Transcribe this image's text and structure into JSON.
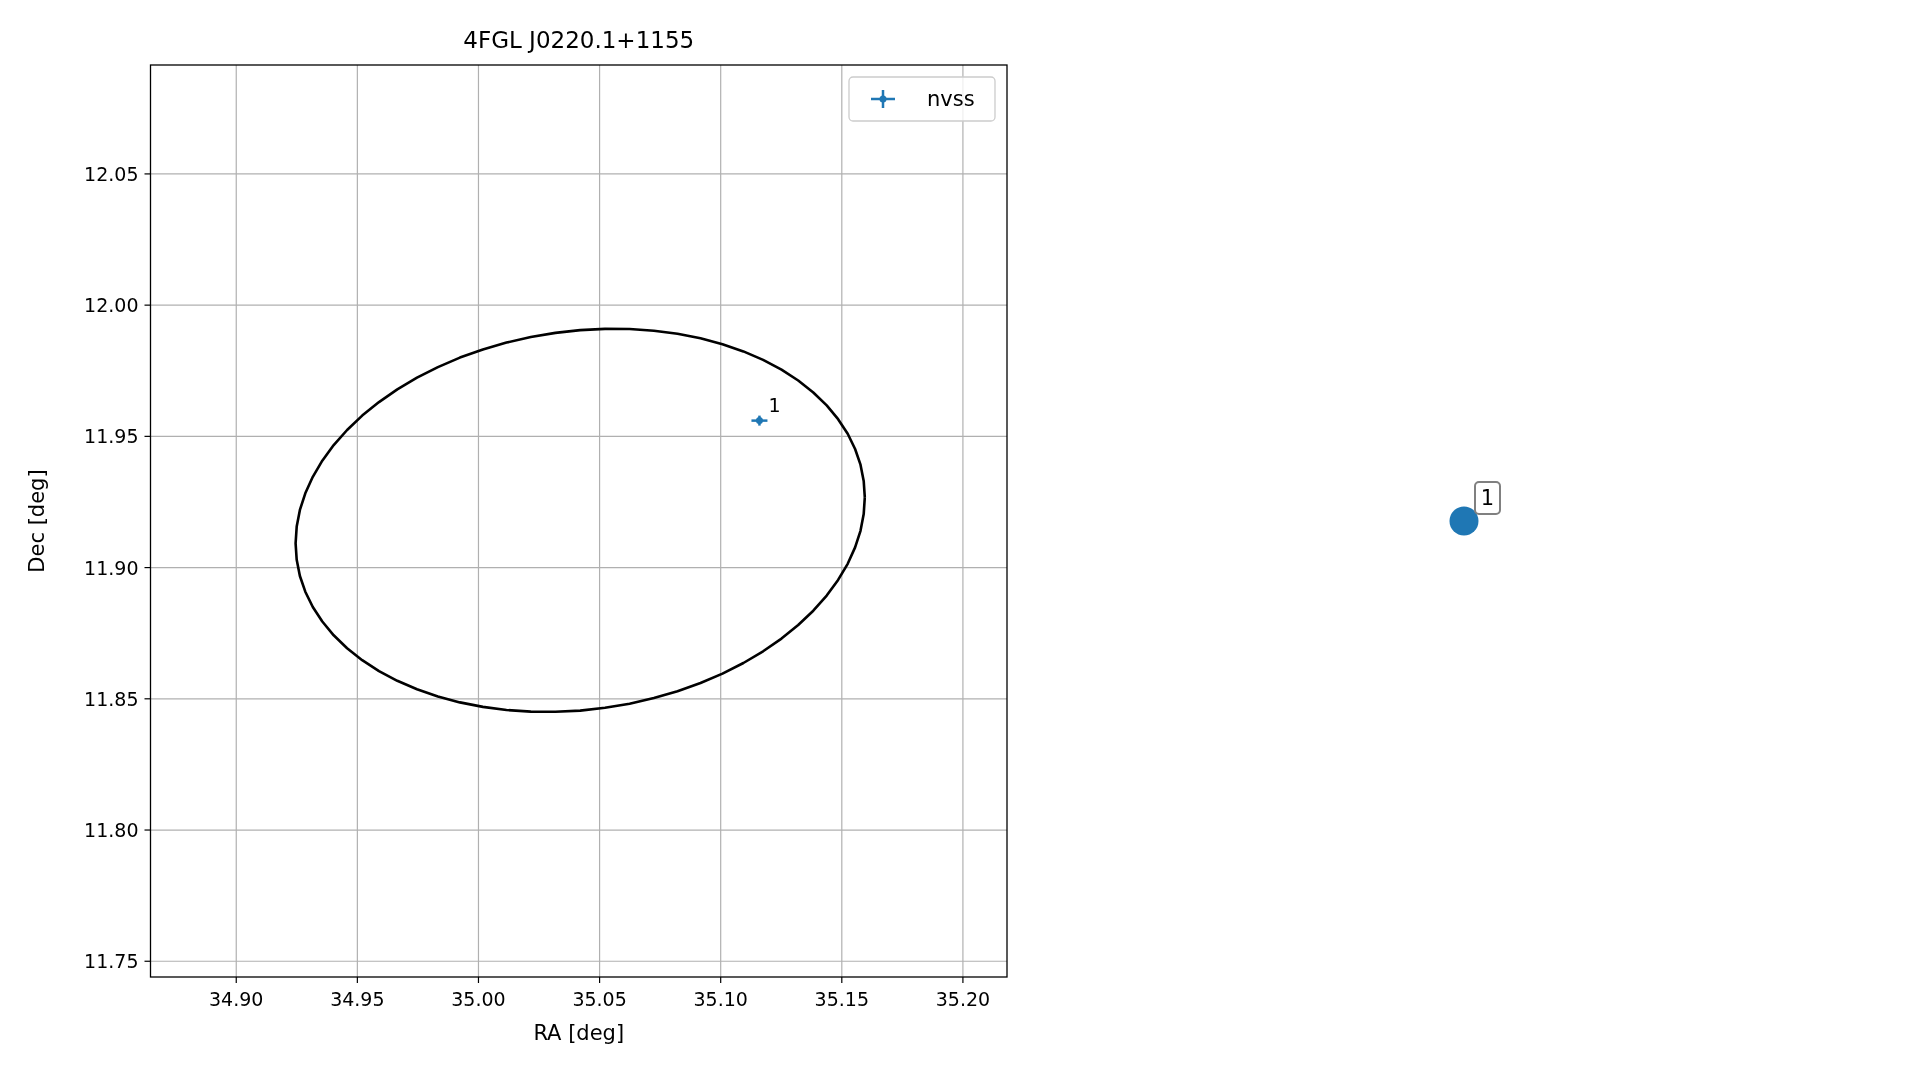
{
  "chart_data": {
    "type": "scatter",
    "title": "4FGL J0220.1+1155",
    "xlabel": "RA [deg]",
    "ylabel": "Dec [deg]",
    "grid": true,
    "xlim": [
      34.8646,
      35.2182
    ],
    "ylim": [
      11.744,
      12.0915
    ],
    "xticks": [
      {
        "value": 34.9,
        "label": "34.90"
      },
      {
        "value": 34.95,
        "label": "34.95"
      },
      {
        "value": 35.0,
        "label": "35.00"
      },
      {
        "value": 35.05,
        "label": "35.05"
      },
      {
        "value": 35.1,
        "label": "35.10"
      },
      {
        "value": 35.15,
        "label": "35.15"
      },
      {
        "value": 35.2,
        "label": "35.20"
      }
    ],
    "yticks": [
      {
        "value": 11.75,
        "label": "11.75"
      },
      {
        "value": 11.8,
        "label": "11.80"
      },
      {
        "value": 11.85,
        "label": "11.85"
      },
      {
        "value": 11.9,
        "label": "11.90"
      },
      {
        "value": 11.95,
        "label": "11.95"
      },
      {
        "value": 12.0,
        "label": "12.00"
      },
      {
        "value": 12.05,
        "label": "12.05"
      }
    ],
    "series": [
      {
        "name": "nvss",
        "color": "#1f77b4",
        "x": [
          35.116
        ],
        "values": [
          11.956
        ]
      }
    ],
    "annotations": [
      {
        "text": "1",
        "x": 35.116,
        "y": 11.956
      }
    ]
  },
  "marker": {
    "label": "1",
    "color": "#1f77b4"
  }
}
